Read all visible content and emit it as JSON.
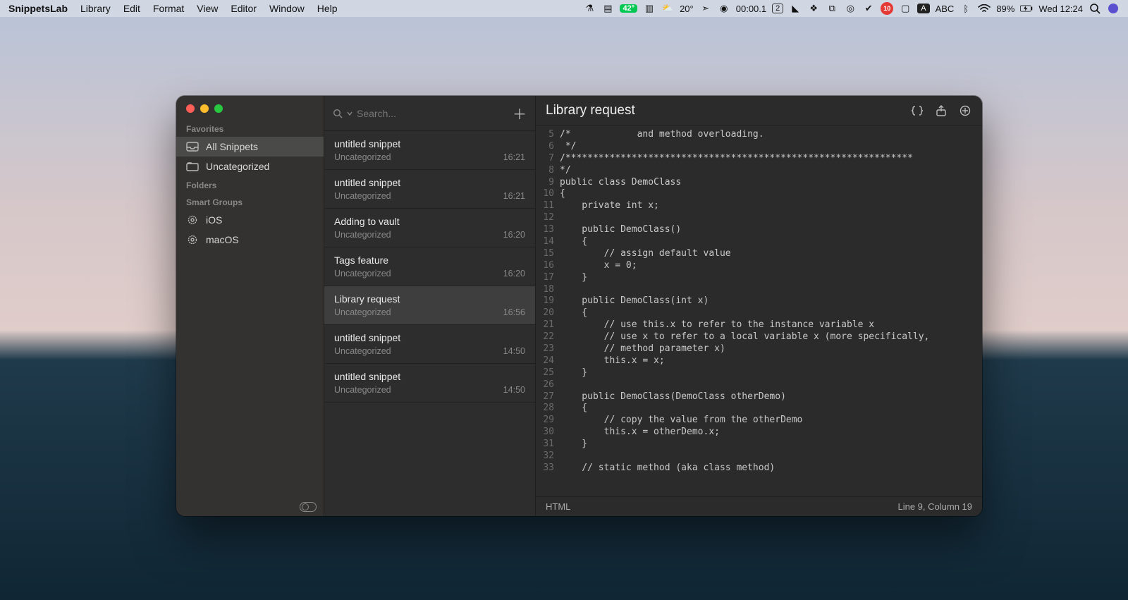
{
  "menubar": {
    "app": "SnippetsLab",
    "items": [
      "Library",
      "Edit",
      "Format",
      "View",
      "Editor",
      "Window",
      "Help"
    ]
  },
  "status": {
    "temp_badge": "42°",
    "weather": "20°",
    "timer": "00:00.1",
    "workspace": "2",
    "input_mode": "A",
    "lang": "ABC",
    "battery_pct": "89%",
    "clock": "Wed 12:24",
    "notif_count": "10"
  },
  "sidebar": {
    "sections": {
      "favorites_label": "Favorites",
      "folders_label": "Folders",
      "smart_label": "Smart Groups"
    },
    "favorites": [
      {
        "label": "All Snippets",
        "icon": "tray",
        "active": true
      },
      {
        "label": "Uncategorized",
        "icon": "folder",
        "active": false
      }
    ],
    "smart": [
      {
        "label": "iOS"
      },
      {
        "label": "macOS"
      }
    ]
  },
  "search": {
    "placeholder": "Search..."
  },
  "snippets": [
    {
      "title": "untitled snippet",
      "category": "Uncategorized",
      "time": "16:21"
    },
    {
      "title": "untitled snippet",
      "category": "Uncategorized",
      "time": "16:21"
    },
    {
      "title": "Adding to vault",
      "category": "Uncategorized",
      "time": "16:20"
    },
    {
      "title": "Tags feature",
      "category": "Uncategorized",
      "time": "16:20"
    },
    {
      "title": "Library request",
      "category": "Uncategorized",
      "time": "16:56",
      "selected": true
    },
    {
      "title": "untitled snippet",
      "category": "Uncategorized",
      "time": "14:50"
    },
    {
      "title": "untitled snippet",
      "category": "Uncategorized",
      "time": "14:50"
    }
  ],
  "editor": {
    "title": "Library request",
    "language": "HTML",
    "cursor": "Line 9, Column 19",
    "gutter_start": 5,
    "lines": [
      "/*            and method overloading.",
      " */",
      "/***************************************************************",
      "*/",
      "public class DemoClass",
      "{",
      "    private int x;|",
      "",
      "    public DemoClass()",
      "    {",
      "        // assign default value",
      "        x = 0;",
      "    }",
      "",
      "    public DemoClass(int x)",
      "    {",
      "        // use this.x to refer to the instance variable x",
      "        // use x to refer to a local variable x (more specifically,",
      "        // method parameter x)",
      "        this.x = x;",
      "    }",
      "",
      "    public DemoClass(DemoClass otherDemo)",
      "    {",
      "        // copy the value from the otherDemo",
      "        this.x = otherDemo.x;",
      "    }",
      "",
      "    // static method (aka class method)"
    ]
  }
}
